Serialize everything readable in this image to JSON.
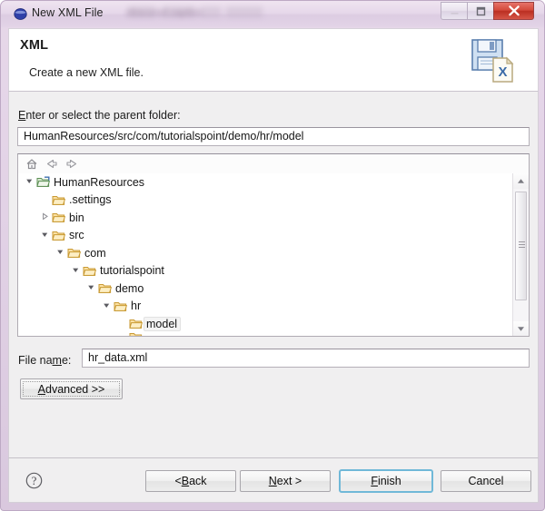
{
  "window": {
    "title": "New XML File",
    "title_ghost": "obscured caption",
    "icon": "eclipse-sphere-icon",
    "controls": {
      "minimize": "minimize-icon",
      "maximize": "maximize-icon",
      "close": "close-icon"
    }
  },
  "header": {
    "title": "XML",
    "description": "Create a new XML file.",
    "icon": "xml-file-save-icon"
  },
  "parent_folder": {
    "label_pre": "E",
    "label_post": "nter or select the parent folder:",
    "path": "HumanResources/src/com/tutorialspoint/demo/hr/model"
  },
  "tree_toolbar": {
    "home": "home-icon",
    "back": "back-arrow-icon",
    "forward": "forward-arrow-icon"
  },
  "tree": {
    "items": [
      {
        "label": "HumanResources",
        "indent": 0,
        "state": "expanded",
        "icon": "project-folder-icon",
        "selected": false
      },
      {
        "label": ".settings",
        "indent": 1,
        "state": "leaf",
        "icon": "folder-icon",
        "selected": false
      },
      {
        "label": "bin",
        "indent": 1,
        "state": "collapsed",
        "icon": "folder-icon",
        "selected": false
      },
      {
        "label": "src",
        "indent": 1,
        "state": "expanded",
        "icon": "folder-icon",
        "selected": false
      },
      {
        "label": "com",
        "indent": 2,
        "state": "expanded",
        "icon": "folder-icon",
        "selected": false
      },
      {
        "label": "tutorialspoint",
        "indent": 3,
        "state": "expanded",
        "icon": "folder-icon",
        "selected": false
      },
      {
        "label": "demo",
        "indent": 4,
        "state": "expanded",
        "icon": "folder-icon",
        "selected": false
      },
      {
        "label": "hr",
        "indent": 5,
        "state": "expanded",
        "icon": "folder-icon",
        "selected": false
      },
      {
        "label": "model",
        "indent": 6,
        "state": "leaf",
        "icon": "folder-icon",
        "selected": true
      }
    ]
  },
  "file_name": {
    "label_pre": "File na",
    "label_mn": "m",
    "label_post": "e:",
    "value": "hr_data.xml"
  },
  "advanced": {
    "label_mn": "A",
    "label_post": "dvanced >>"
  },
  "buttons": {
    "help": "help-icon",
    "back_pre": "< ",
    "back_mn": "B",
    "back_post": "ack",
    "next_mn": "N",
    "next_post": "ext >",
    "finish_mn": "F",
    "finish_post": "inish",
    "cancel": "Cancel"
  },
  "colors": {
    "frame": "#e2d2e6",
    "close_button": "#c9382a",
    "default_button_border": "#70b8d8",
    "panel": "#f0eff0",
    "folder": "#f5c462"
  }
}
